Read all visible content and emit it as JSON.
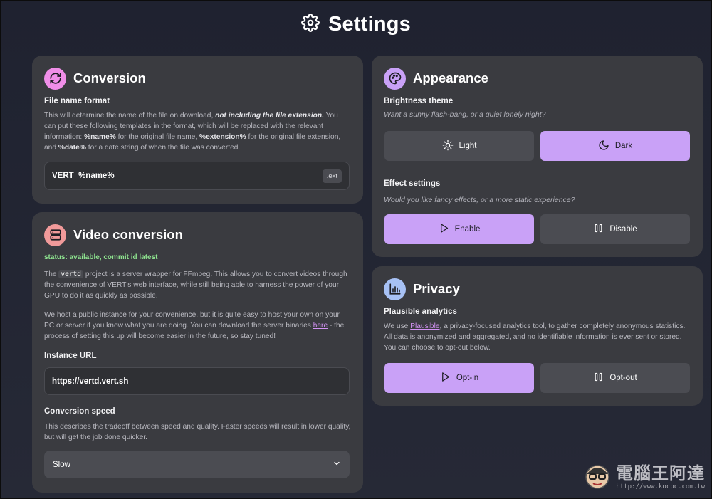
{
  "header": {
    "title": "Settings",
    "icon": "gear-icon"
  },
  "conversion": {
    "title": "Conversion",
    "file_name_label": "File name format",
    "desc_1": "This will determine the name of the file on download, ",
    "desc_italic": "not including the file extension.",
    "desc_2": " You can put these following templates in the format, which will be replaced with the relevant information: ",
    "tpl_name": "%name%",
    "desc_3": " for the original file name, ",
    "tpl_ext": "%extension%",
    "desc_4": " for the original file extension, and ",
    "tpl_date": "%date%",
    "desc_5": " for a date string of when the file was converted.",
    "format_value": "VERT_%name%",
    "ext_badge": ".ext"
  },
  "video": {
    "title": "Video conversion",
    "status": "status: available, commit id latest",
    "p1_a": "The ",
    "p1_code": "vertd",
    "p1_b": " project is a server wrapper for FFmpeg. This allows you to convert videos through the convenience of VERT's web interface, while still being able to harness the power of your GPU to do it as quickly as possible.",
    "p2_a": "We host a public instance for your convenience, but it is quite easy to host your own on your PC or server if you know what you are doing. You can download the server binaries ",
    "p2_link": "here",
    "p2_b": " - the process of setting this up will become easier in the future, so stay tuned!",
    "instance_label": "Instance URL",
    "instance_value": "https://vertd.vert.sh",
    "speed_label": "Conversion speed",
    "speed_desc": "This describes the tradeoff between speed and quality. Faster speeds will result in lower quality, but will get the job done quicker.",
    "speed_value": "Slow"
  },
  "appearance": {
    "title": "Appearance",
    "brightness_label": "Brightness theme",
    "brightness_desc": "Want a sunny flash-bang, or a quiet lonely night?",
    "light_label": "Light",
    "dark_label": "Dark",
    "effect_label": "Effect settings",
    "effect_desc": "Would you like fancy effects, or a more static experience?",
    "enable_label": "Enable",
    "disable_label": "Disable"
  },
  "privacy": {
    "title": "Privacy",
    "analytics_label": "Plausible analytics",
    "desc_a": "We use ",
    "desc_link": "Plausible",
    "desc_b": ", a privacy-focused analytics tool, to gather completely anonymous statistics. All data is anonymized and aggregated, and no identifiable information is ever sent or stored. You can choose to opt-out below.",
    "optin_label": "Opt-in",
    "optout_label": "Opt-out"
  },
  "watermark": {
    "text": "電腦王阿達",
    "url": "http://www.kocpc.com.tw"
  },
  "colors": {
    "accent": "#c9a1f7",
    "conversion_badge": "#f08ee8",
    "video_badge": "#f19a9a",
    "appearance_badge": "#c9a1f7",
    "privacy_badge": "#a7c1f5",
    "status_green": "#8ee38f"
  }
}
